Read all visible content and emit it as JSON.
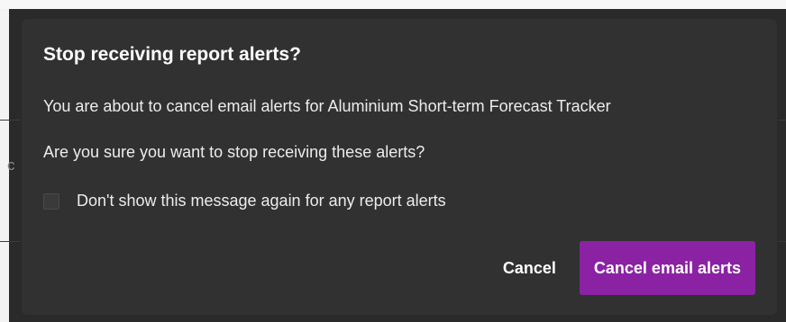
{
  "background": {
    "partial_text": "c"
  },
  "dialog": {
    "title": "Stop receiving report alerts?",
    "message": "You are about to cancel email alerts for Aluminium Short-term Forecast Tracker",
    "question": "Are you sure you want to stop receiving these alerts?",
    "checkbox": {
      "label": "Don't show this message again for any report alerts",
      "checked": false
    },
    "buttons": {
      "cancel_label": "Cancel",
      "confirm_label": "Cancel email alerts"
    }
  },
  "colors": {
    "dialog_bg": "#313131",
    "primary_button": "#8a22a3",
    "text": "#ececec"
  }
}
